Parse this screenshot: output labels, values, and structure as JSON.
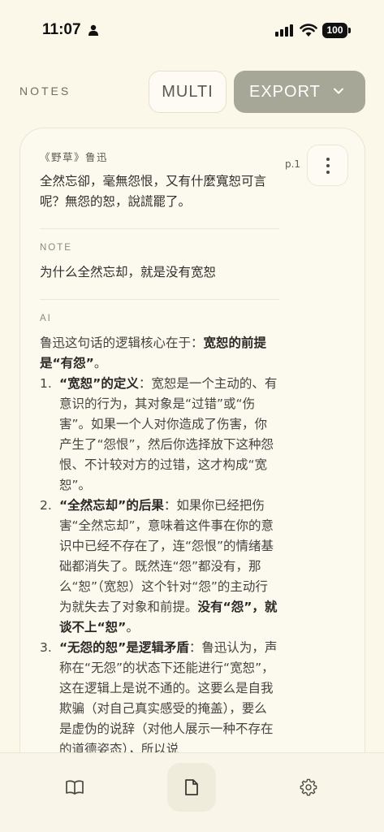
{
  "status_bar": {
    "time": "11:07",
    "battery": "100",
    "icons": [
      "person-icon",
      "signal-icon",
      "wifi-icon",
      "battery-icon"
    ]
  },
  "header": {
    "title": "NOTES",
    "multi_label": "MULTI",
    "export_label": "EXPORT",
    "export_icon": "chevron-down-icon"
  },
  "card": {
    "source": "《野草》鲁迅",
    "page": "p.1",
    "quote": "全然忘卻，毫無怨恨，又有什麼寬恕可言呢？無怨的恕，說謊罷了。",
    "note_label": "NOTE",
    "note": "为什么全然忘却，就是没有宽恕",
    "ai_label": "AI",
    "ai_intro": "鲁迅这句话的逻辑核心在于：",
    "ai_intro_bold": "宽恕的前提是“有怨”",
    "ai_intro_end": "。",
    "ai_points": [
      {
        "num": "1.",
        "bold": "“宽恕”的定义",
        "text": "：宽恕是一个主动的、有意识的行为，其对象是“过错”或“伤害”。如果一个人对你造成了伤害，你产生了“怨恨”，然后你选择放下这种怨恨、不计较对方的过错，这才构成“宽恕”。",
        "bold_end": "",
        "tail": ""
      },
      {
        "num": "2.",
        "bold": "“全然忘却”的后果",
        "text": "：如果你已经把伤害“全然忘却”，意味着这件事在你的意识中已经不存在了，连“怨恨”的情绪基础都消失了。既然连“怨”都没有，那么“恕”（宽恕）这个针对“怨”的主动行为就失去了对象和前提。",
        "bold_end": "没有“怨”，就谈不上“恕”",
        "tail": "。"
      },
      {
        "num": "3.",
        "bold": "“无怨的恕”是逻辑矛盾",
        "text": "：鲁迅认为，声称在“无怨”的状态下还能进行“宽恕”，这在逻辑上是说不通的。这要么是自我欺骗（对自己真实感受的掩盖），要么是虚伪的说辞（对他人展示一种不存在的道德姿态），所以说",
        "bold_end": "",
        "tail": ""
      }
    ]
  },
  "bottom_nav": {
    "tabs": [
      {
        "name": "library",
        "icon": "book-icon",
        "active": false
      },
      {
        "name": "notes",
        "icon": "note-icon",
        "active": true
      },
      {
        "name": "settings",
        "icon": "gear-icon",
        "active": false
      }
    ]
  },
  "colors": {
    "background": "#fbf7e9",
    "export_button": "#a6a796",
    "text": "#2f2e2a"
  }
}
